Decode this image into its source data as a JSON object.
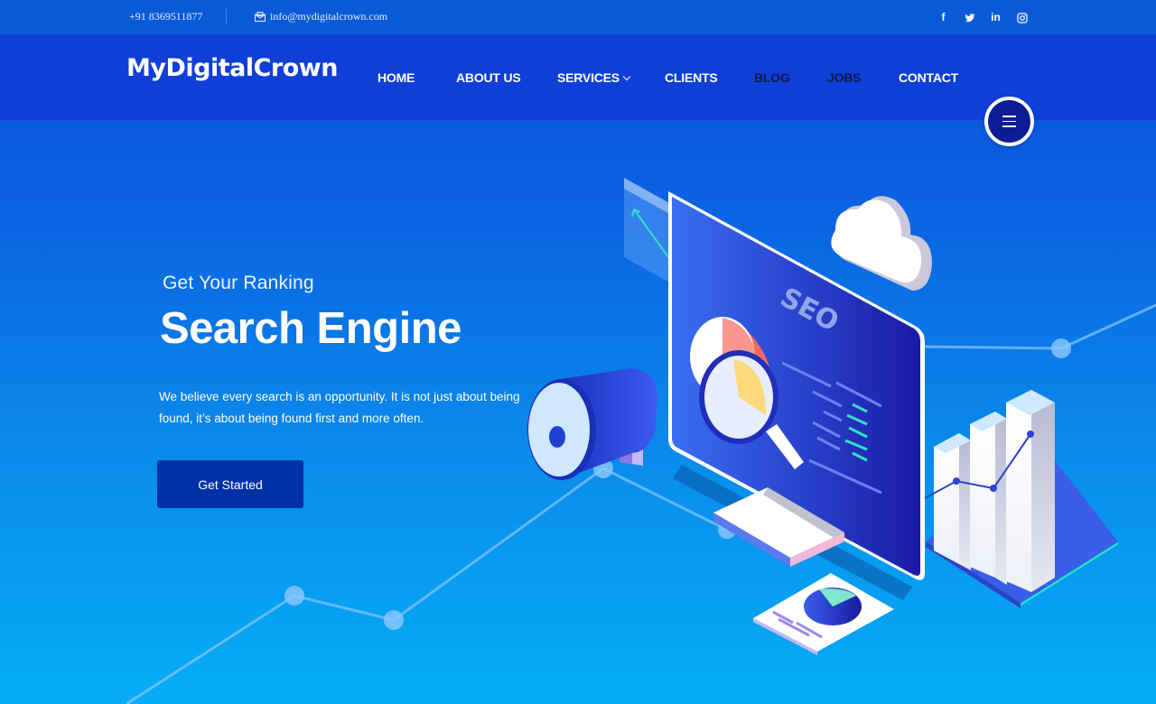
{
  "topbar": {
    "phone": "+91 8369511877",
    "email": "info@mydigitalcrown.com",
    "email_icon": "envelope-icon",
    "social": [
      {
        "name": "facebook",
        "icon": "facebook-icon"
      },
      {
        "name": "twitter",
        "icon": "twitter-icon"
      },
      {
        "name": "linkedin",
        "icon": "linkedin-icon"
      },
      {
        "name": "instagram",
        "icon": "instagram-icon"
      }
    ]
  },
  "navbar": {
    "logo": {
      "part1": "MyDigital",
      "part2": "Crown"
    },
    "items": [
      {
        "label": "HOME"
      },
      {
        "label": "ABOUT US"
      },
      {
        "label": "SERVICES",
        "has_dropdown": true
      },
      {
        "label": "CLIENTS"
      },
      {
        "label": "BLOG"
      },
      {
        "label": "JOBS"
      },
      {
        "label": "CONTACT"
      }
    ],
    "menu_icon": "hamburger-icon"
  },
  "hero": {
    "subtitle": "Get Your Ranking",
    "title": "Search Engine",
    "description": "We believe every search is an opportunity. It is not just about being found, it’s about being found first and more often.",
    "cta_label": "Get Started",
    "illustration": {
      "screen_label": "SEO"
    }
  },
  "colors": {
    "topbar_bg": "#0b5bd9",
    "navbar_bg": "#0f3fd6",
    "cta_bg": "#0030a8",
    "menu_btn_bg": "#0c1d94",
    "accent_teal": "#35e0c8"
  }
}
